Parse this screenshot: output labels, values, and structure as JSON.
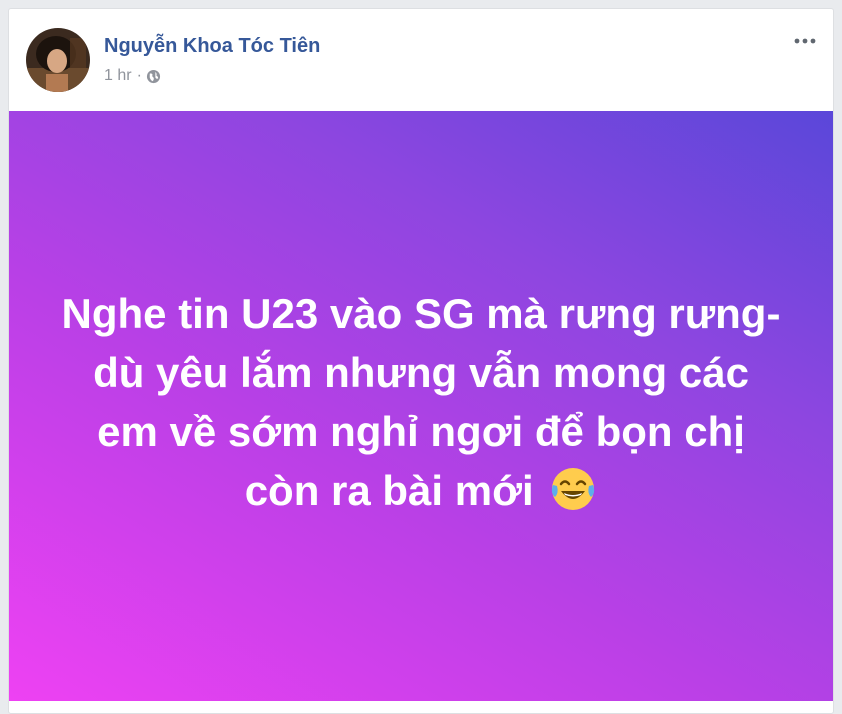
{
  "post": {
    "author_name": "Nguyễn Khoa Tóc Tiên",
    "timestamp": "1 hr",
    "separator": "·",
    "privacy_icon": "globe-icon",
    "menu_icon": "more-options-icon",
    "text": "Nghe tin U23 vào SG mà rưng rưng-dù yêu lắm nhưng vẫn mong các em về sớm nghỉ ngơi để bọn chị còn ra bài mới",
    "emoji": "face-with-tears-of-joy-icon",
    "background_gradient": [
      "#ee41f3",
      "#b940e6",
      "#8d46e0",
      "#5a47d9"
    ]
  },
  "colors": {
    "name_link": "#365899",
    "meta_text": "#90949c",
    "post_text": "#ffffff"
  }
}
